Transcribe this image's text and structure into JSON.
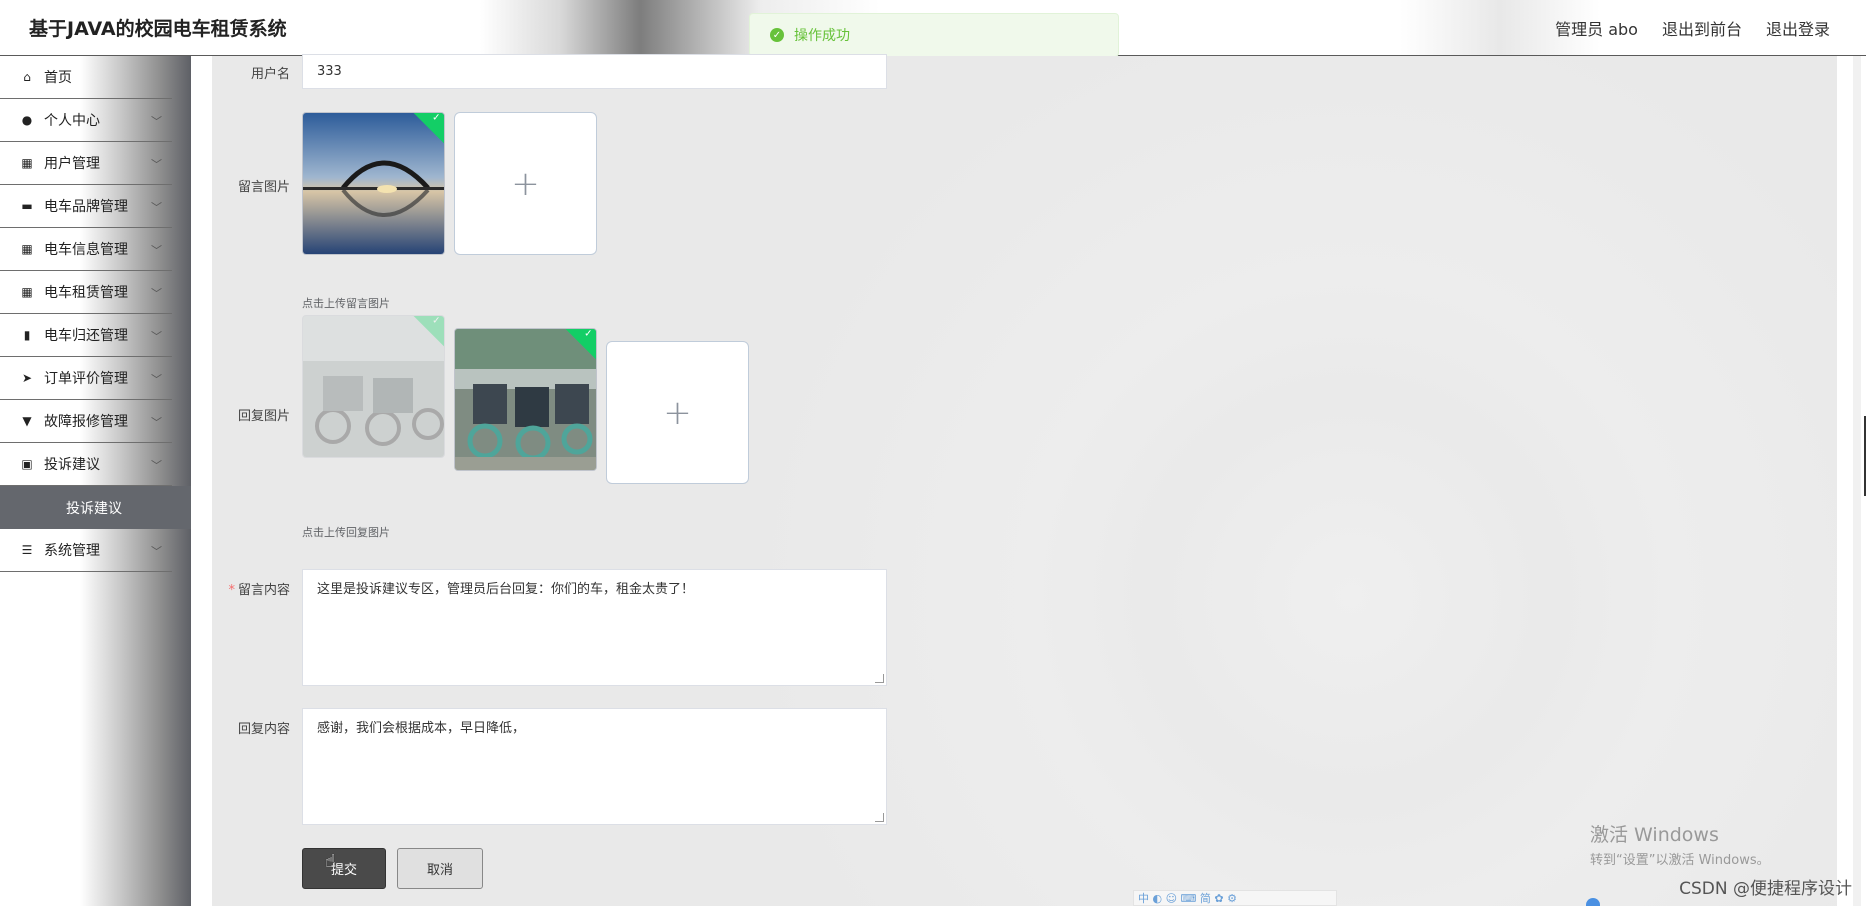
{
  "header": {
    "title": "基于JAVA的校园电车租赁系统",
    "user": "管理员 abo",
    "to_front": "退出到前台",
    "logout": "退出登录"
  },
  "toast": {
    "icon": "check-circle-icon",
    "text": "操作成功"
  },
  "sidebar": {
    "items": [
      {
        "label": "首页",
        "icon": "home-icon"
      },
      {
        "label": "个人中心",
        "icon": "user-icon"
      },
      {
        "label": "用户管理",
        "icon": "grid-icon"
      },
      {
        "label": "电车品牌管理",
        "icon": "briefcase-icon"
      },
      {
        "label": "电车信息管理",
        "icon": "grid-icon"
      },
      {
        "label": "电车租赁管理",
        "icon": "grid-icon"
      },
      {
        "label": "电车归还管理",
        "icon": "tablet-icon"
      },
      {
        "label": "订单评价管理",
        "icon": "send-icon"
      },
      {
        "label": "故障报修管理",
        "icon": "stamp-icon"
      },
      {
        "label": "投诉建议",
        "icon": "clipboard-icon"
      }
    ],
    "active_sub": "投诉建议",
    "last_item": {
      "label": "系统管理",
      "icon": "list-icon"
    }
  },
  "form": {
    "username_label": "用户名",
    "username_value": "333",
    "msg_image_label": "留言图片",
    "msg_image_hint": "点击上传留言图片",
    "reply_image_label": "回复图片",
    "reply_image_hint": "点击上传回复图片",
    "content_label": "留言内容",
    "content_value": "这里是投诉建议专区，管理员后台回复：你们的车，租金太贵了！",
    "reply_label": "回复内容",
    "reply_value": "感谢，我们会根据成本，早日降低，",
    "submit": "提交",
    "cancel": "取消"
  },
  "overlay": {
    "win_title": "激活 Windows",
    "win_sub": "转到“设置”以激活 Windows。",
    "watermark": "CSDN @便捷程序设计",
    "ime": "中 ◐ ☺ ⌨ 简 ✿ ⚙"
  }
}
